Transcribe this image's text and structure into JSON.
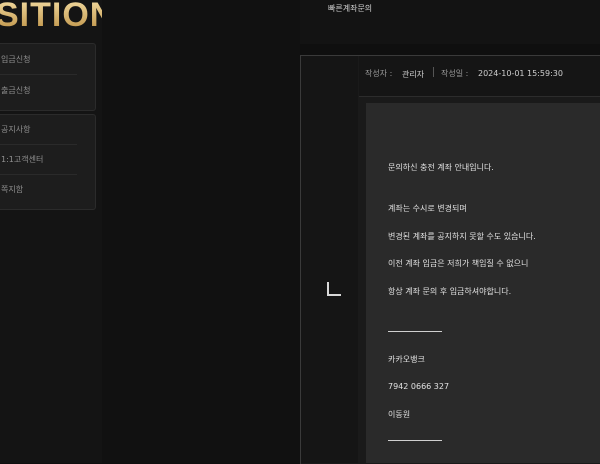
{
  "logo": {
    "text": "SITION"
  },
  "sidebar": {
    "group1": [
      {
        "label": "입금신청"
      },
      {
        "label": "출금신청"
      }
    ],
    "group2": [
      {
        "label": "공지사항"
      },
      {
        "label": "1:1고객센터"
      },
      {
        "label": "쪽지함"
      }
    ]
  },
  "header": {
    "title": "빠른계좌문의"
  },
  "meta": {
    "author_label": "작성자 :",
    "author": "관리자",
    "date_label": "작성일 :",
    "date": "2024-10-01 15:59:30"
  },
  "post": {
    "lines": [
      "문의하신 충전 계좌 안내입니다.",
      "계좌는 수시로 변경되며",
      "변경된 계좌를 공지하지 못할 수도 있습니다.",
      "이전 계좌 입금은 저희가 책임질 수 없으니",
      "항상 계좌 문의 후 입금하셔야합니다.",
      "카카오뱅크",
      "7942 0666 327",
      "이동원"
    ]
  }
}
